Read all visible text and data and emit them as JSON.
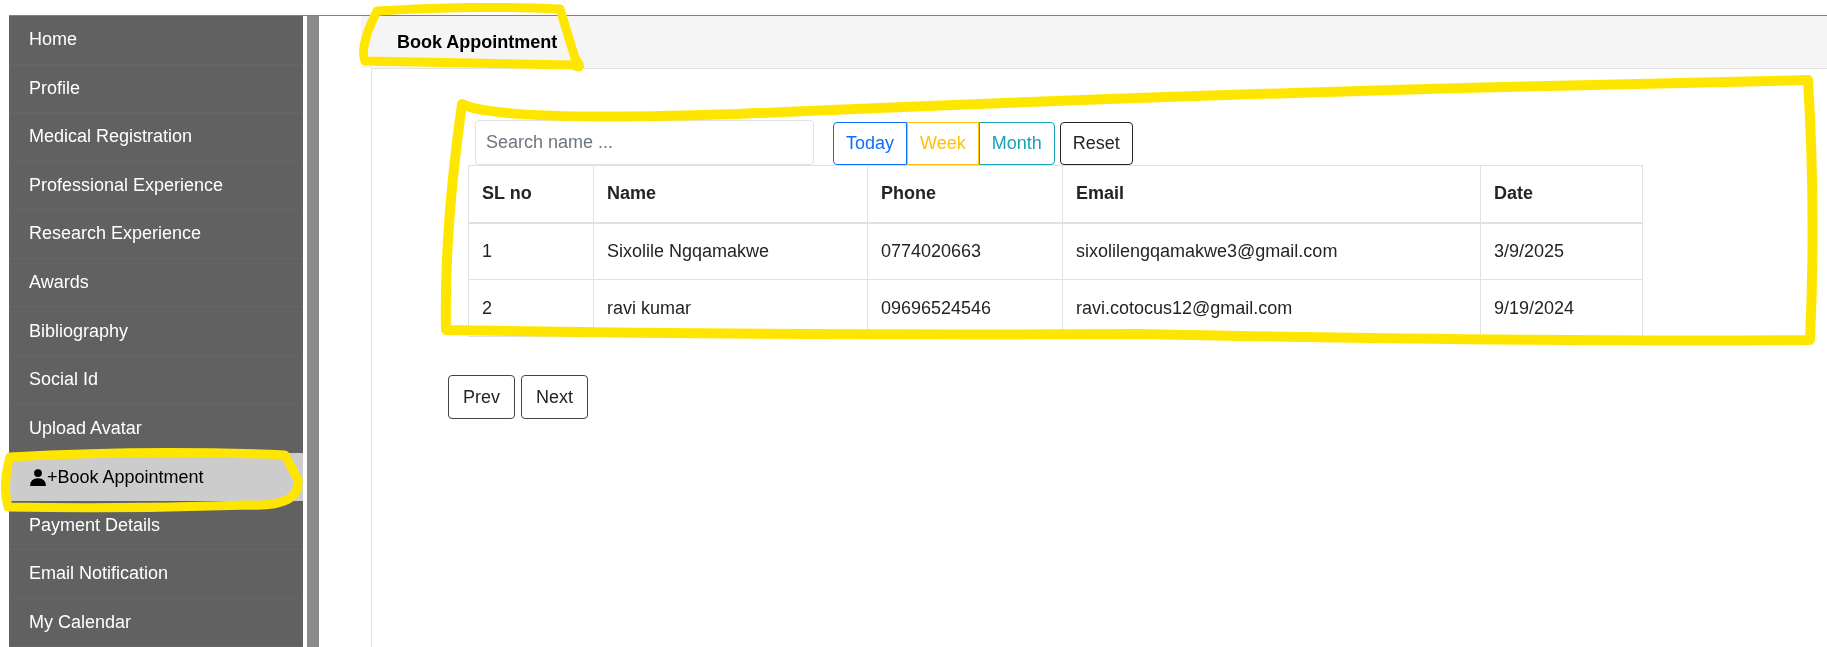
{
  "sidebar": {
    "items": [
      {
        "label": "Home",
        "selected": false
      },
      {
        "label": "Profile",
        "selected": false
      },
      {
        "label": "Medical Registration",
        "selected": false
      },
      {
        "label": "Professional Experience",
        "selected": false
      },
      {
        "label": "Research Experience",
        "selected": false
      },
      {
        "label": "Awards",
        "selected": false
      },
      {
        "label": "Bibliography",
        "selected": false
      },
      {
        "label": "Social Id",
        "selected": false
      },
      {
        "label": "Upload Avatar",
        "selected": false
      },
      {
        "label": "+Book Appointment",
        "selected": true
      },
      {
        "label": "Payment Details",
        "selected": false
      },
      {
        "label": "Email Notification",
        "selected": false
      },
      {
        "label": "My Calendar",
        "selected": false
      }
    ]
  },
  "tab": {
    "label": "Book Appointment"
  },
  "search": {
    "placeholder": "Search name ..."
  },
  "filters": [
    {
      "label": "Today",
      "color": "#0d6efd"
    },
    {
      "label": "Week",
      "color": "#ffc107"
    },
    {
      "label": "Month",
      "color": "#17a2b8"
    },
    {
      "label": "Reset",
      "color": "#212529"
    }
  ],
  "table": {
    "columns": [
      "SL no",
      "Name",
      "Phone",
      "Email",
      "Date"
    ],
    "rows": [
      [
        "1",
        "Sixolile Ngqamakwe",
        "0774020663",
        "sixolilengqamakwe3@gmail.com",
        "3/9/2025"
      ],
      [
        "2",
        "ravi kumar",
        "09696524546",
        "ravi.cotocus12@gmail.com",
        "9/19/2024"
      ]
    ]
  },
  "pagination": [
    "Prev",
    "Next"
  ]
}
